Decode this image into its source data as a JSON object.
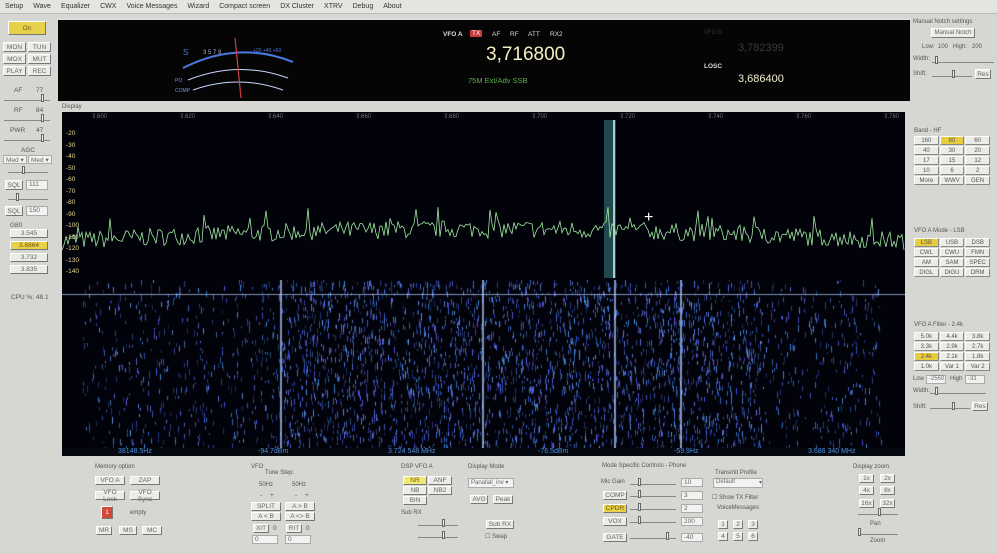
{
  "menu": [
    "Setup",
    "Wave",
    "Equalizer",
    "CWX",
    "Voice Messages",
    "Wizard",
    "Compact screen",
    "DX Cluster",
    "XTRV",
    "Debug",
    "About"
  ],
  "left": {
    "on": "On",
    "mon": "MON",
    "tun": "TUN",
    "mox": "MOX",
    "mut": "MUT",
    "play": "PLAY",
    "rec": "REC",
    "af_label": "AF",
    "af_value": "77",
    "rf_label": "RF",
    "rf_value": "84",
    "pwr_label": "PWR",
    "pwr_value": "47",
    "agc_label": "AGC",
    "agc1": "Med",
    "agc2": "Med",
    "sql": "SQL",
    "sql1_value": "111",
    "sql2_value": "150",
    "band_label": "G80",
    "band_mem": [
      "3.545",
      "3.6864",
      "3.732",
      "3.835"
    ],
    "cpu": "CPU %: 48.1"
  },
  "vfo": {
    "vfoa": "VFO A",
    "tx": "TX",
    "af": "AF",
    "rf": "RF",
    "att": "ATT",
    "rx2": "RX2",
    "freq_a": "3,716800",
    "band_text": "75M Ext/Adv SSB",
    "vfob": "VFO B",
    "freq_b": "3,782399",
    "losc": "LOSC",
    "losc_freq": "3,686400"
  },
  "notch": {
    "title": "Manual Notch settings",
    "button": "Manual Notch",
    "low_label": "Low:",
    "low": "100",
    "high_label": "High:",
    "high": "200",
    "width": "Width:",
    "shift": "Shift:",
    "res": "Res"
  },
  "display": {
    "label": "Display",
    "freq_ticks": [
      "3.600",
      "3.620",
      "3.640",
      "3.660",
      "3.680",
      "3.700",
      "3.720",
      "3.740",
      "3.760",
      "3.780"
    ],
    "db_ticks": [
      "-20",
      "-30",
      "-40",
      "-50",
      "-60",
      "-70",
      "-80",
      "-90",
      "-100",
      "-110",
      "-120",
      "-130",
      "-140"
    ]
  },
  "status": [
    "38148.5Hz",
    "-94.7dBm",
    "3.724 548 MHz",
    "-76.5dBm",
    "-59.9Hz",
    "3.686 340 MHz"
  ],
  "band": {
    "title": "Band - HF",
    "items": [
      "160",
      "80",
      "60",
      "40",
      "30",
      "20",
      "17",
      "15",
      "12",
      "10",
      "6",
      "2",
      "More",
      "WWV",
      "GEN"
    ],
    "active": "80"
  },
  "mode": {
    "title": "VFO A Mode - LSB",
    "items": [
      "LSB",
      "USB",
      "DSB",
      "CWL",
      "CWU",
      "FMN",
      "AM",
      "SAM",
      "SPEC",
      "DIGL",
      "DIGU",
      "DRM"
    ],
    "active": "LSB"
  },
  "filter": {
    "title": "VFO A Filter - 2.4k",
    "items": [
      "5.0k",
      "4.4k",
      "3.8k",
      "3.3k",
      "2.9k",
      "2.7k",
      "2.4k",
      "2.1k",
      "1.8k",
      "1.0k",
      "Var 1",
      "Var 2"
    ],
    "active": "2.4k",
    "low_label": "Low",
    "low": "-2550",
    "high_label": "High",
    "high": "-31",
    "width": "Width:",
    "shift": "Shift:",
    "res": "Res"
  },
  "memory": {
    "title": "Memory option",
    "vfoa": "VFO A",
    "zap": "ZAP",
    "lock": "VFO Lock",
    "sync": "VFO Sync",
    "num": "1",
    "empty": "empty",
    "mr": "MR",
    "ms": "MS",
    "mc": "MC"
  },
  "vfoctl": {
    "title": "VFO",
    "tune_step": "Tune Step:",
    "step1": "50Hz",
    "step2": "50Hz",
    "minus": "-",
    "plus": "+",
    "split": "SPLIT",
    "atob": "A > B",
    "afromb": "A < B",
    "swap": "A <> B",
    "xit": "XIT",
    "xit_v": "0",
    "rit": "RIT",
    "rit_v": "0",
    "xit_val": "0",
    "rit_val": "0"
  },
  "dsp": {
    "title": "DSP VFO A",
    "nr": "NR",
    "anf": "ANF",
    "nb": "NB",
    "nb2": "NB2",
    "bin": "BIN",
    "subrx": "Sub RX"
  },
  "dmode": {
    "title": "Display Mode",
    "value": "Panafall_inv",
    "avg": "AVG",
    "peak": "Peak",
    "subrx": "Sub RX",
    "swap": "Swap"
  },
  "phone": {
    "title": "Mode Specific Controls - Phone",
    "mic": "Mic Gain",
    "mic_v": "10",
    "comp": "COMP",
    "comp_v": "3",
    "cpdr": "CPDR",
    "cpdr_v": "2",
    "vox": "VOX",
    "vox_v": "200",
    "gate": "GATE",
    "gate_v": "-40"
  },
  "txprof": {
    "title": "Transmit Profile",
    "value": "Default",
    "show": "Show TX Filter",
    "vm": "VoiceMessages",
    "keys": [
      "1",
      "2",
      "3",
      "4",
      "5",
      "6"
    ]
  },
  "zoom": {
    "title": "Display zoom",
    "items": [
      "1x",
      "2x",
      "4x",
      "8x",
      "16x",
      "32x"
    ],
    "pan": "Pan",
    "zoom": "Zoom"
  },
  "colors": {
    "accent": "#e8d04a",
    "spectrum": "#9fe8a0",
    "waterfall": "#3a6ae0"
  }
}
